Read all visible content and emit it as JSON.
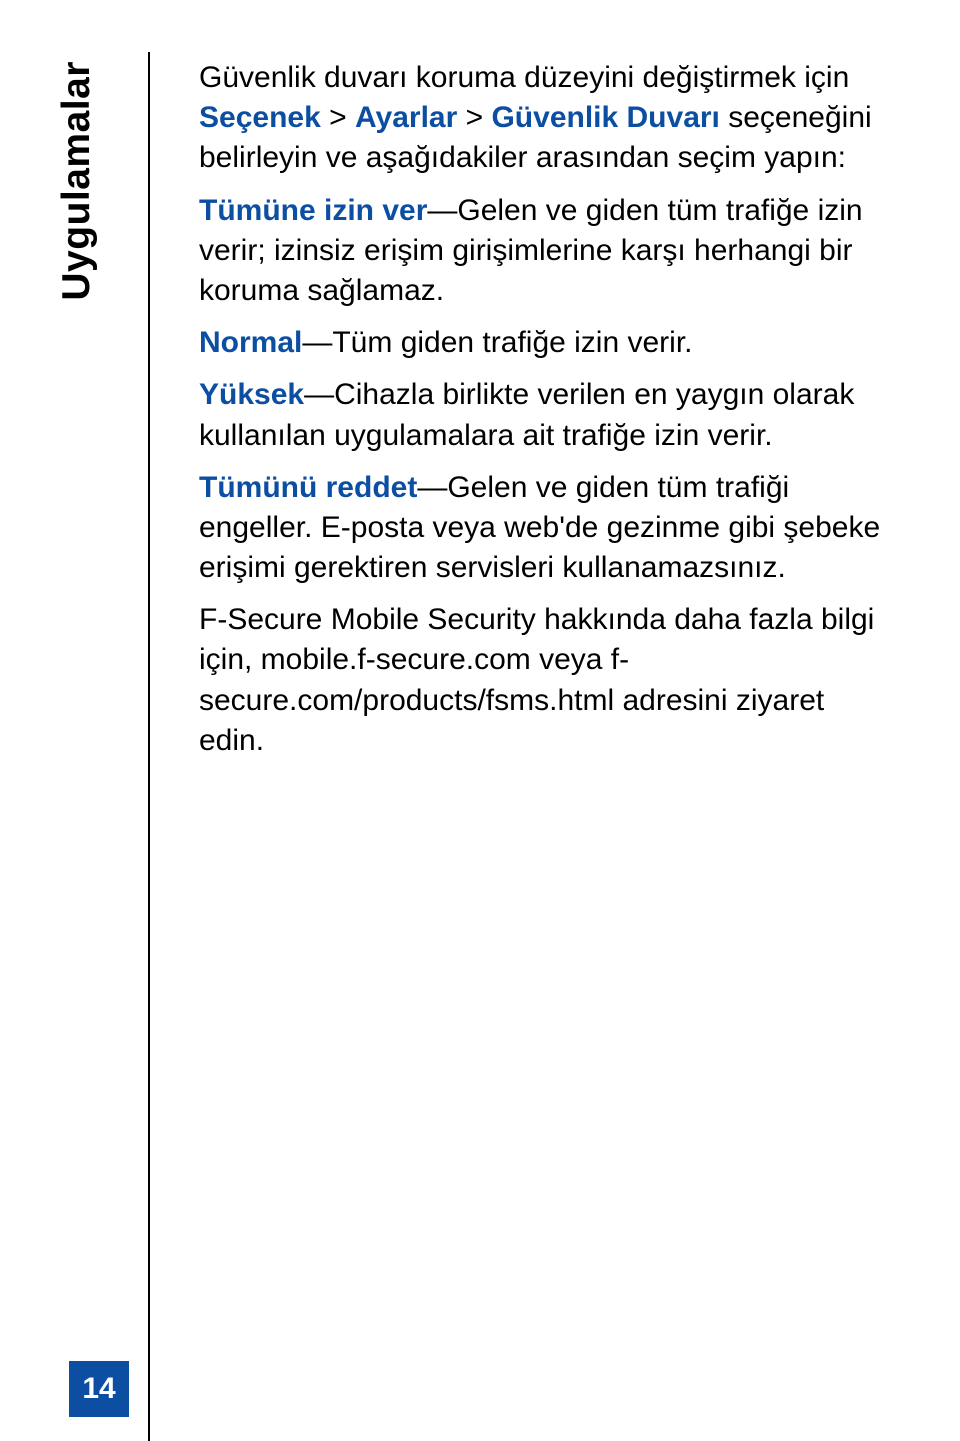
{
  "side_tab": "Uygulamalar",
  "page_number": "14",
  "p1": {
    "a": "Güvenlik duvarı koruma düzeyini değiştirmek için ",
    "opt": "Seçenek",
    "sep1": " > ",
    "ayar": "Ayarlar",
    "sep2": " > ",
    "gd": "Güvenlik Duvarı",
    "b": " seçeneğini belirleyin ve aşağıdakiler arasından seçim yapın:"
  },
  "p2": {
    "term": "Tümüne izin ver",
    "rest": "—Gelen ve giden tüm trafiğe izin verir; izinsiz erişim girişimlerine karşı herhangi bir koruma sağlamaz."
  },
  "p3": {
    "term": "Normal",
    "rest": "—Tüm giden trafiğe izin verir."
  },
  "p4": {
    "term": "Yüksek",
    "rest": "—Cihazla birlikte verilen en yaygın olarak kullanılan uygulamalara ait trafiğe izin verir."
  },
  "p5": {
    "term": "Tümünü reddet",
    "rest": "—Gelen ve giden tüm trafiği engeller. E-posta veya web'de gezinme gibi şebeke erişimi gerektiren servisleri kullanamazsınız."
  },
  "p6": "F-Secure Mobile Security hakkında daha fazla bilgi için, mobile.f-secure.com veya f-secure.com/products/fsms.html adresini ziyaret edin."
}
